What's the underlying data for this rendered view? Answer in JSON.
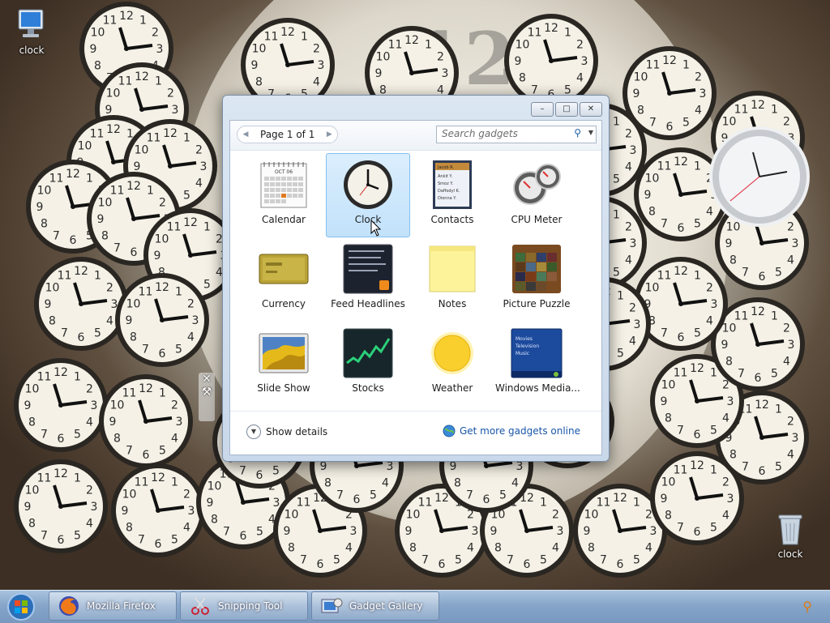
{
  "desktop": {
    "icons": [
      {
        "name": "computer-icon",
        "label": "clock"
      },
      {
        "name": "recycle-bin-icon",
        "label": "clock"
      }
    ]
  },
  "gallery": {
    "title_buttons": {
      "minimize": "–",
      "maximize": "□",
      "close": "✕"
    },
    "pager": {
      "label": "Page 1 of 1",
      "prev": "◀",
      "next": "▶"
    },
    "search": {
      "placeholder": "Search gadgets",
      "icon": "search-icon"
    },
    "gadgets": [
      {
        "label": "Calendar",
        "icon": "calendar-icon",
        "selected": false
      },
      {
        "label": "Clock",
        "icon": "clock-icon",
        "selected": true
      },
      {
        "label": "Contacts",
        "icon": "contacts-icon",
        "selected": false
      },
      {
        "label": "CPU Meter",
        "icon": "cpu-meter-icon",
        "selected": false
      },
      {
        "label": "Currency",
        "icon": "currency-icon",
        "selected": false
      },
      {
        "label": "Feed Headlines",
        "icon": "feed-icon",
        "selected": false
      },
      {
        "label": "Notes",
        "icon": "notes-icon",
        "selected": false
      },
      {
        "label": "Picture Puzzle",
        "icon": "puzzle-icon",
        "selected": false
      },
      {
        "label": "Slide Show",
        "icon": "slideshow-icon",
        "selected": false
      },
      {
        "label": "Stocks",
        "icon": "stocks-icon",
        "selected": false
      },
      {
        "label": "Weather",
        "icon": "weather-icon",
        "selected": false
      },
      {
        "label": "Windows Media...",
        "icon": "media-center-icon",
        "selected": false
      }
    ],
    "calendar_thumb": {
      "month": "OCT 06"
    },
    "contacts_thumb": {
      "header": "Jacob R.",
      "names": [
        "Ankit Y.",
        "Smoz Y.",
        "Daffodyl K.",
        "Dionna Y."
      ]
    },
    "media_thumb": {
      "lines": [
        "Movies",
        "Television",
        "Music"
      ]
    },
    "footer": {
      "show_details": "Show details",
      "get_more": "Get more gadgets online"
    }
  },
  "taskbar": {
    "items": [
      {
        "label": "Mozilla Firefox"
      },
      {
        "label": "Snipping Tool"
      },
      {
        "label": "Gadget Gallery"
      }
    ]
  },
  "colors": {
    "accent": "#1a56a8",
    "selection": "#c2e2fb",
    "taskbar": "#86a5c9"
  }
}
